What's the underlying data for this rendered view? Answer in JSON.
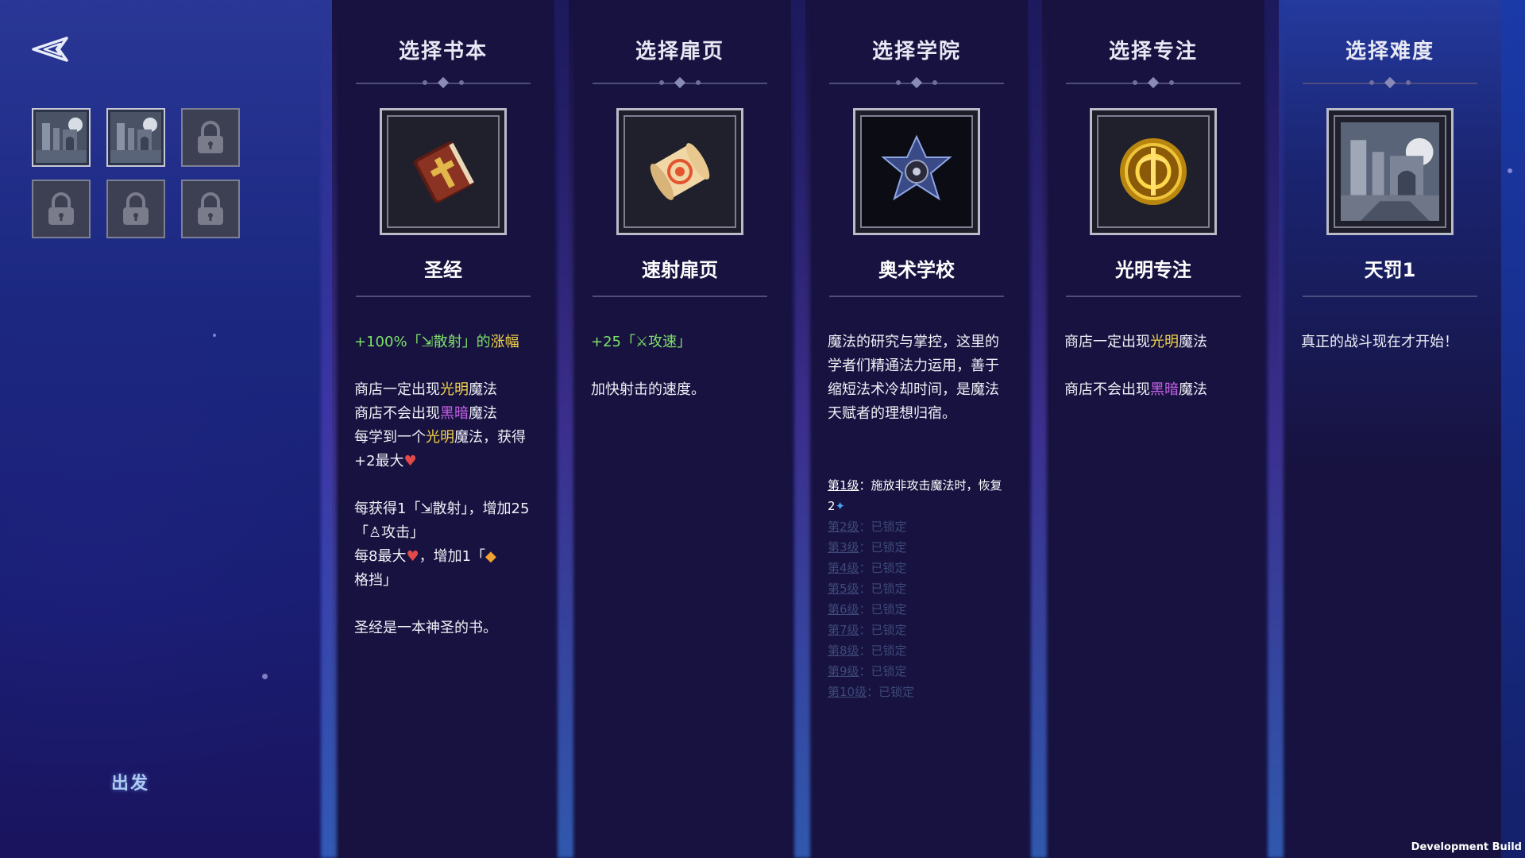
{
  "slots": {
    "items": [
      {
        "state": "filled",
        "icon": "castle-ruins-icon"
      },
      {
        "state": "filled",
        "icon": "castle-ruins-icon"
      },
      {
        "state": "locked",
        "icon": "lock-icon"
      },
      {
        "state": "locked",
        "icon": "lock-icon"
      },
      {
        "state": "locked",
        "icon": "lock-icon"
      },
      {
        "state": "locked",
        "icon": "lock-icon"
      }
    ]
  },
  "depart_label": "出发",
  "dev_label": "Development Build",
  "columns": {
    "book": {
      "title": "选择书本",
      "choice": "圣经",
      "icon": "bible-icon",
      "line1_a": "+100%「",
      "line1_b": "散射」的",
      "line1_c": "涨幅",
      "line2_a": "商店一定出现",
      "line2_b": "光明",
      "line2_c": "魔法",
      "line3_a": "商店不会出现",
      "line3_b": "黑暗",
      "line3_c": "魔法",
      "line4_a": "每学到一个",
      "line4_b": "光明",
      "line4_c": "魔法，获得+2最大",
      "line5_a": "每获得1「",
      "line5_b": "散射」，增加25「",
      "line5_c": "攻击」",
      "line6_a": "每8最大",
      "line6_b": "，增加1「",
      "line6_c": "格挡」",
      "line7": "圣经是一本神圣的书。"
    },
    "page": {
      "title": "选择扉页",
      "choice": "速射扉页",
      "icon": "scroll-icon",
      "line1_a": "+25「",
      "line1_b": "攻速」",
      "line2": "加快射击的速度。"
    },
    "school": {
      "title": "选择学院",
      "choice": "奥术学校",
      "icon": "arcane-star-icon",
      "text": "魔法的研究与掌控，这里的学者们精通法力运用，善于缩短法术冷却时间，是魔法天赋者的理想归宿。",
      "levels": [
        {
          "name": "第1级",
          "text": "：施放非攻击魔法时，恢复2",
          "locked": false
        },
        {
          "name": "第2级",
          "text": "：已锁定",
          "locked": true
        },
        {
          "name": "第3级",
          "text": "：已锁定",
          "locked": true
        },
        {
          "name": "第4级",
          "text": "：已锁定",
          "locked": true
        },
        {
          "name": "第5级",
          "text": "：已锁定",
          "locked": true
        },
        {
          "name": "第6级",
          "text": "：已锁定",
          "locked": true
        },
        {
          "name": "第7级",
          "text": "：已锁定",
          "locked": true
        },
        {
          "name": "第8级",
          "text": "：已锁定",
          "locked": true
        },
        {
          "name": "第9级",
          "text": "：已锁定",
          "locked": true
        },
        {
          "name": "第10级",
          "text": "：已锁定",
          "locked": true
        }
      ]
    },
    "focus": {
      "title": "选择专注",
      "choice": "光明专注",
      "icon": "light-emblem-icon",
      "line1_a": "商店一定出现",
      "line1_b": "光明",
      "line1_c": "魔法",
      "line2_a": "商店不会出现",
      "line2_b": "黑暗",
      "line2_c": "魔法"
    },
    "difficulty": {
      "title": "选择难度",
      "choice": "天罚1",
      "icon": "castle-ruins-icon",
      "line1": "真正的战斗现在才开始！"
    }
  },
  "colors": {
    "green": "#7ee06a",
    "yellow": "#f2d44a",
    "purple": "#c862e8",
    "red": "#e24a4a"
  }
}
